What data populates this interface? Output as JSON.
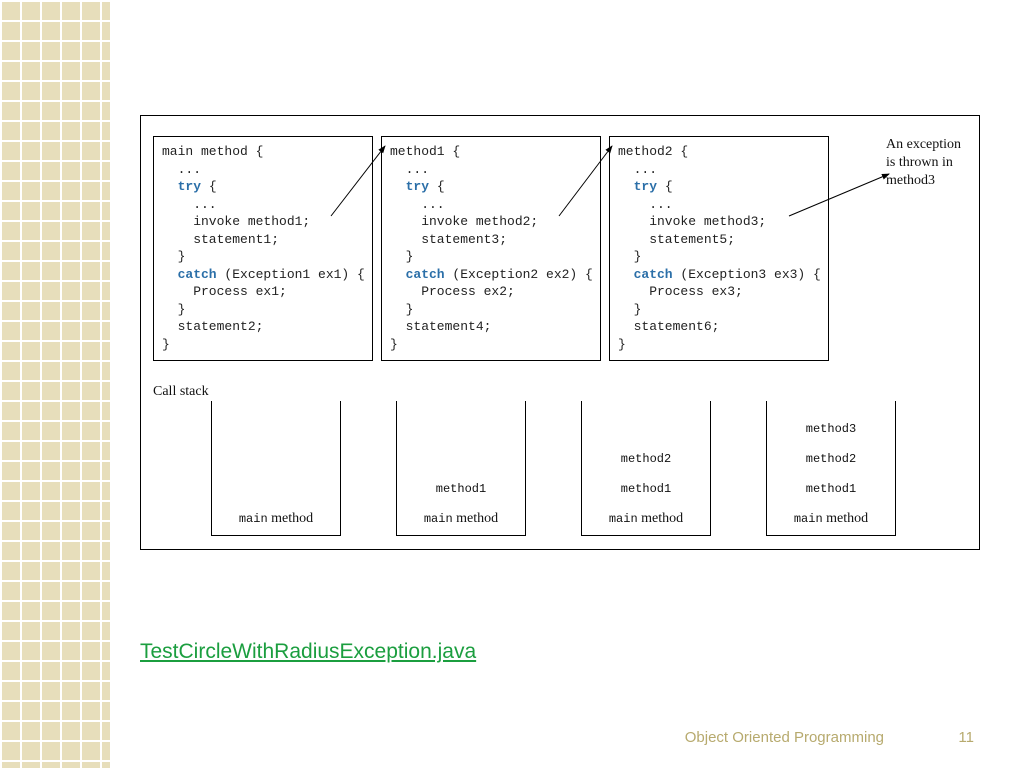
{
  "link_text": "TestCircleWithRadiusException.java",
  "footer": {
    "title": "Object Oriented Programming",
    "page": "11"
  },
  "annotation": {
    "l1": "An exception",
    "l2": "is thrown in",
    "l3": "method3"
  },
  "call_stack_label": "Call stack",
  "code": {
    "box1": {
      "line1": "main method {",
      "dots1": "  ...",
      "try": "  try",
      "brace_o": " {",
      "dots2": "    ...",
      "invoke": "    invoke method1;",
      "stmt_in": "    statement1;",
      "close_try": "  }",
      "catch": "  catch",
      "catch_tail": " (Exception1 ex1) {",
      "proc": "    Process ex1;",
      "close_catch": "  }",
      "stmt_after": "  statement2;",
      "close": "}"
    },
    "box2": {
      "line1": "method1 {",
      "dots1": "  ...",
      "try": "  try",
      "brace_o": " {",
      "dots2": "    ...",
      "invoke": "    invoke method2;",
      "stmt_in": "    statement3;",
      "close_try": "  }",
      "catch": "  catch",
      "catch_tail": " (Exception2 ex2) {",
      "proc": "    Process ex2;",
      "close_catch": "  }",
      "stmt_after": "  statement4;",
      "close": "}"
    },
    "box3": {
      "line1": "method2 {",
      "dots1": "  ...",
      "try": "  try",
      "brace_o": " {",
      "dots2": "    ...",
      "invoke": "    invoke method3;",
      "stmt_in": "    statement5;",
      "close_try": "  }",
      "catch": "  catch",
      "catch_tail": " (Exception3 ex3) {",
      "proc": "    Process ex3;",
      "close_catch": "  }",
      "stmt_after": "  statement6;",
      "close": "}"
    }
  },
  "stacks": {
    "s1": {
      "c1a": "main",
      "c1b": " method"
    },
    "s2": {
      "c1": "method1",
      "c2a": "main",
      "c2b": " method"
    },
    "s3": {
      "c1": "method2",
      "c2": "method1",
      "c3a": "main",
      "c3b": " method"
    },
    "s4": {
      "c1": "method3",
      "c2": "method2",
      "c3": "method1",
      "c4a": "main",
      "c4b": " method"
    }
  }
}
